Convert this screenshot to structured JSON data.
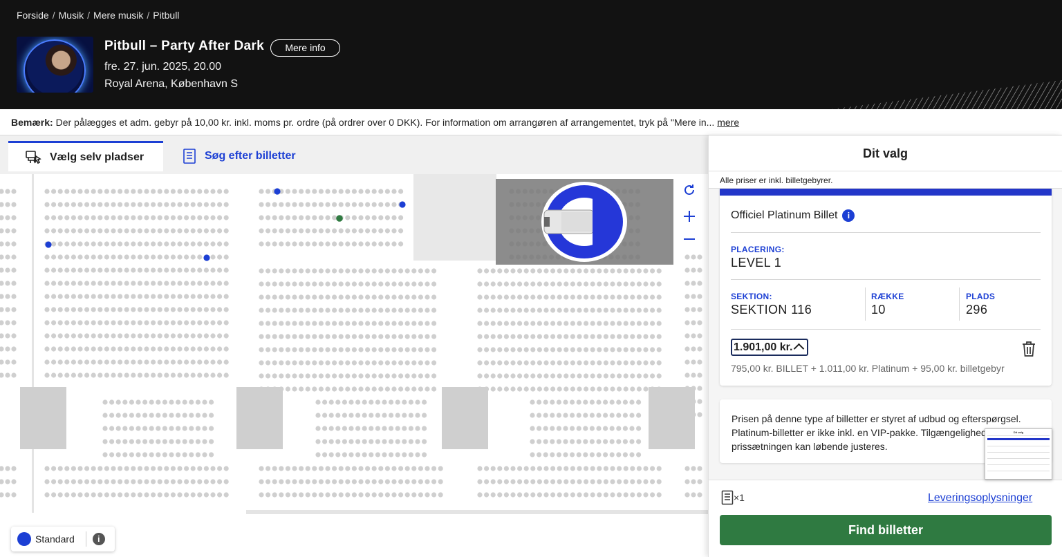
{
  "breadcrumb": [
    "Forside",
    "Musik",
    "Mere musik",
    "Pitbull"
  ],
  "event": {
    "title": "Pitbull – Party After Dark",
    "more_info": "Mere info",
    "date": "fre. 27. jun. 2025, 20.00",
    "venue": "Royal Arena, København S"
  },
  "notice": {
    "label": "Bemærk:",
    "text": "Der pålægges et adm. gebyr på 10,00 kr. inkl. moms pr. ordre (på ordrer over 0 DKK). For information om arrangøren af arrangementet, tryk på \"Mere in...",
    "more": "mere"
  },
  "tabs": [
    {
      "label": "Vælg selv pladser",
      "active": true
    },
    {
      "label": "Søg efter billetter",
      "active": false
    }
  ],
  "legend": {
    "label": "Standard",
    "info": "i"
  },
  "panel": {
    "title": "Dit valg",
    "subtitle": "Alle priser er inkl. billetgebyrer.",
    "ticket_name": "Officiel Platinum Billet",
    "placering_label": "PLACERING:",
    "placering_value": "LEVEL 1",
    "sektion_label": "SEKTION:",
    "sektion_value": "SEKTION 116",
    "raekke_label": "RÆKKE",
    "raekke_value": "10",
    "plads_label": "PLADS",
    "plads_value": "296",
    "price": "1.901,00 kr.",
    "breakdown": "795,00 kr. BILLET + 1.011,00 kr. Platinum + 95,00 kr. billetgebyr",
    "note": "Prisen på denne type af billetter er styret af udbud og efterspørgsel. Platinum-billetter er ikke inkl. en VIP-pakke. Tilgængeligheden og prissætningen kan løbende justeres.",
    "quantity": "×1",
    "delivery": "Leveringsoplysninger",
    "find_button": "Find billetter"
  },
  "colors": {
    "accent": "#1c3fd4",
    "header_bg": "#121212",
    "cta": "#2f7a41",
    "seat_available": "#cfcfcf",
    "seat_selected": "#1c3fd4"
  }
}
